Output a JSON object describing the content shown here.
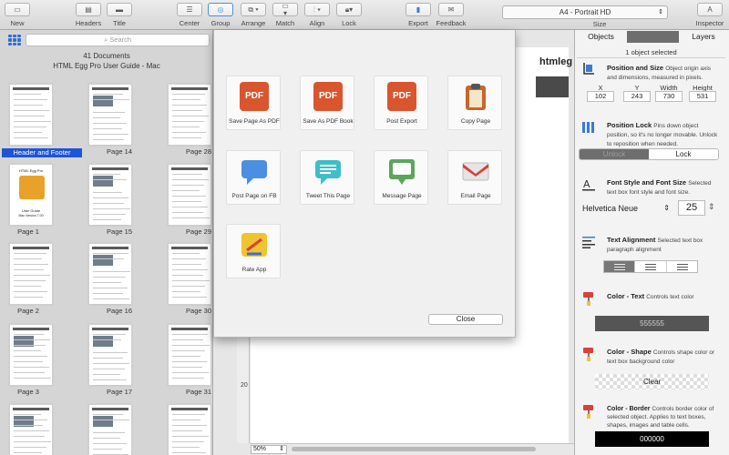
{
  "toolbar": {
    "new": "New",
    "headers": "Headers",
    "title": "Title",
    "center": "Center",
    "group": "Group",
    "arrange": "Arrange",
    "match": "Match",
    "align": "Align",
    "lock": "Lock",
    "export": "Export",
    "feedback": "Feedback",
    "size_value": "A4 - Portrait HD",
    "size_label": "Size",
    "inspector": "Inspector"
  },
  "sidebar": {
    "search_placeholder": "Search",
    "doc_count": "41 Documents",
    "doc_title": "HTML Egg Pro User Guide - Mac",
    "selected_label": "Header and Footer",
    "pages": [
      {
        "label": ""
      },
      {
        "label": "Page 14"
      },
      {
        "label": "Page 28"
      },
      {
        "label": "Page 1"
      },
      {
        "label": "Page 15"
      },
      {
        "label": "Page 29"
      },
      {
        "label": "Page 2"
      },
      {
        "label": "Page 16"
      },
      {
        "label": "Page 30"
      },
      {
        "label": "Page 3"
      },
      {
        "label": "Page 17"
      },
      {
        "label": "Page 31"
      },
      {
        "label": ""
      },
      {
        "label": ""
      },
      {
        "label": ""
      }
    ],
    "cover_title": "HTML Egg Pro",
    "cover_sub": "User Guide",
    "cover_ver": "Mac Version 7.00"
  },
  "canvas": {
    "doc_heading": "htmleg",
    "zoom": "50%",
    "ruler_mark": "20"
  },
  "share": {
    "items": [
      {
        "label": "Save Page As PDF",
        "icon": "pdf-icon"
      },
      {
        "label": "Save As PDF Book",
        "icon": "pdf-icon"
      },
      {
        "label": "Post Export",
        "icon": "pdf-icon"
      },
      {
        "label": "Copy Page",
        "icon": "clipboard-icon"
      },
      {
        "label": "Post Page on FB",
        "icon": "chat-bubble-icon"
      },
      {
        "label": "Tweet This Page",
        "icon": "tweet-bubble-icon"
      },
      {
        "label": "Message Page",
        "icon": "message-icon"
      },
      {
        "label": "Email Page",
        "icon": "email-icon"
      },
      {
        "label": "Rate App",
        "icon": "rate-icon"
      }
    ],
    "pdf_text": "PDF",
    "close": "Close"
  },
  "inspector": {
    "tabs": [
      "Objects",
      "Format",
      "Layers"
    ],
    "selected": "1 object selected",
    "pos_title": "Position and Size",
    "pos_desc": "Object origin axis and dimensions, measured in pixels.",
    "fields": [
      {
        "label": "X",
        "value": "102"
      },
      {
        "label": "Y",
        "value": "243"
      },
      {
        "label": "Width",
        "value": "730"
      },
      {
        "label": "Height",
        "value": "531"
      }
    ],
    "lock_title": "Position Lock",
    "lock_desc": "Pins down object position, so it's no longer movable.  Unlock to reposition when needed.",
    "unlock": "Unlock",
    "lock": "Lock",
    "font_title": "Font Style and Font Size",
    "font_desc": "Selected text box font style and font size.",
    "font_name": "Helvetica Neue",
    "font_size": "25",
    "align_title": "Text Alignment",
    "align_desc": "Selected text box paragraph alignment",
    "text_color_title": "Color - Text",
    "text_color_desc": "Controls text color",
    "text_color_value": "555555",
    "shape_color_title": "Color - Shape",
    "shape_color_desc": "Controls shape color or text box background color",
    "shape_color_value": "Clear",
    "border_color_title": "Color - Border",
    "border_color_desc": "Controls border color of selected object.  Applies to text boxes, shapes, images and table cells.",
    "border_color_value": "000000"
  },
  "colors": {
    "accent": "#1e55d8",
    "pdf": "#d9552e",
    "text_swatch": "#555555",
    "border_swatch": "#000000"
  }
}
